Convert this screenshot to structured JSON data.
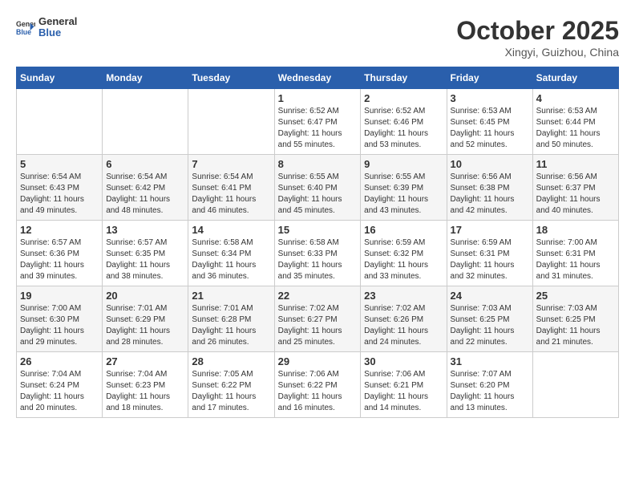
{
  "header": {
    "logo_line1": "General",
    "logo_line2": "Blue",
    "month": "October 2025",
    "location": "Xingyi, Guizhou, China"
  },
  "weekdays": [
    "Sunday",
    "Monday",
    "Tuesday",
    "Wednesday",
    "Thursday",
    "Friday",
    "Saturday"
  ],
  "weeks": [
    [
      {
        "day": "",
        "info": ""
      },
      {
        "day": "",
        "info": ""
      },
      {
        "day": "",
        "info": ""
      },
      {
        "day": "1",
        "info": "Sunrise: 6:52 AM\nSunset: 6:47 PM\nDaylight: 11 hours and 55 minutes."
      },
      {
        "day": "2",
        "info": "Sunrise: 6:52 AM\nSunset: 6:46 PM\nDaylight: 11 hours and 53 minutes."
      },
      {
        "day": "3",
        "info": "Sunrise: 6:53 AM\nSunset: 6:45 PM\nDaylight: 11 hours and 52 minutes."
      },
      {
        "day": "4",
        "info": "Sunrise: 6:53 AM\nSunset: 6:44 PM\nDaylight: 11 hours and 50 minutes."
      }
    ],
    [
      {
        "day": "5",
        "info": "Sunrise: 6:54 AM\nSunset: 6:43 PM\nDaylight: 11 hours and 49 minutes."
      },
      {
        "day": "6",
        "info": "Sunrise: 6:54 AM\nSunset: 6:42 PM\nDaylight: 11 hours and 48 minutes."
      },
      {
        "day": "7",
        "info": "Sunrise: 6:54 AM\nSunset: 6:41 PM\nDaylight: 11 hours and 46 minutes."
      },
      {
        "day": "8",
        "info": "Sunrise: 6:55 AM\nSunset: 6:40 PM\nDaylight: 11 hours and 45 minutes."
      },
      {
        "day": "9",
        "info": "Sunrise: 6:55 AM\nSunset: 6:39 PM\nDaylight: 11 hours and 43 minutes."
      },
      {
        "day": "10",
        "info": "Sunrise: 6:56 AM\nSunset: 6:38 PM\nDaylight: 11 hours and 42 minutes."
      },
      {
        "day": "11",
        "info": "Sunrise: 6:56 AM\nSunset: 6:37 PM\nDaylight: 11 hours and 40 minutes."
      }
    ],
    [
      {
        "day": "12",
        "info": "Sunrise: 6:57 AM\nSunset: 6:36 PM\nDaylight: 11 hours and 39 minutes."
      },
      {
        "day": "13",
        "info": "Sunrise: 6:57 AM\nSunset: 6:35 PM\nDaylight: 11 hours and 38 minutes."
      },
      {
        "day": "14",
        "info": "Sunrise: 6:58 AM\nSunset: 6:34 PM\nDaylight: 11 hours and 36 minutes."
      },
      {
        "day": "15",
        "info": "Sunrise: 6:58 AM\nSunset: 6:33 PM\nDaylight: 11 hours and 35 minutes."
      },
      {
        "day": "16",
        "info": "Sunrise: 6:59 AM\nSunset: 6:32 PM\nDaylight: 11 hours and 33 minutes."
      },
      {
        "day": "17",
        "info": "Sunrise: 6:59 AM\nSunset: 6:31 PM\nDaylight: 11 hours and 32 minutes."
      },
      {
        "day": "18",
        "info": "Sunrise: 7:00 AM\nSunset: 6:31 PM\nDaylight: 11 hours and 31 minutes."
      }
    ],
    [
      {
        "day": "19",
        "info": "Sunrise: 7:00 AM\nSunset: 6:30 PM\nDaylight: 11 hours and 29 minutes."
      },
      {
        "day": "20",
        "info": "Sunrise: 7:01 AM\nSunset: 6:29 PM\nDaylight: 11 hours and 28 minutes."
      },
      {
        "day": "21",
        "info": "Sunrise: 7:01 AM\nSunset: 6:28 PM\nDaylight: 11 hours and 26 minutes."
      },
      {
        "day": "22",
        "info": "Sunrise: 7:02 AM\nSunset: 6:27 PM\nDaylight: 11 hours and 25 minutes."
      },
      {
        "day": "23",
        "info": "Sunrise: 7:02 AM\nSunset: 6:26 PM\nDaylight: 11 hours and 24 minutes."
      },
      {
        "day": "24",
        "info": "Sunrise: 7:03 AM\nSunset: 6:25 PM\nDaylight: 11 hours and 22 minutes."
      },
      {
        "day": "25",
        "info": "Sunrise: 7:03 AM\nSunset: 6:25 PM\nDaylight: 11 hours and 21 minutes."
      }
    ],
    [
      {
        "day": "26",
        "info": "Sunrise: 7:04 AM\nSunset: 6:24 PM\nDaylight: 11 hours and 20 minutes."
      },
      {
        "day": "27",
        "info": "Sunrise: 7:04 AM\nSunset: 6:23 PM\nDaylight: 11 hours and 18 minutes."
      },
      {
        "day": "28",
        "info": "Sunrise: 7:05 AM\nSunset: 6:22 PM\nDaylight: 11 hours and 17 minutes."
      },
      {
        "day": "29",
        "info": "Sunrise: 7:06 AM\nSunset: 6:22 PM\nDaylight: 11 hours and 16 minutes."
      },
      {
        "day": "30",
        "info": "Sunrise: 7:06 AM\nSunset: 6:21 PM\nDaylight: 11 hours and 14 minutes."
      },
      {
        "day": "31",
        "info": "Sunrise: 7:07 AM\nSunset: 6:20 PM\nDaylight: 11 hours and 13 minutes."
      },
      {
        "day": "",
        "info": ""
      }
    ]
  ]
}
